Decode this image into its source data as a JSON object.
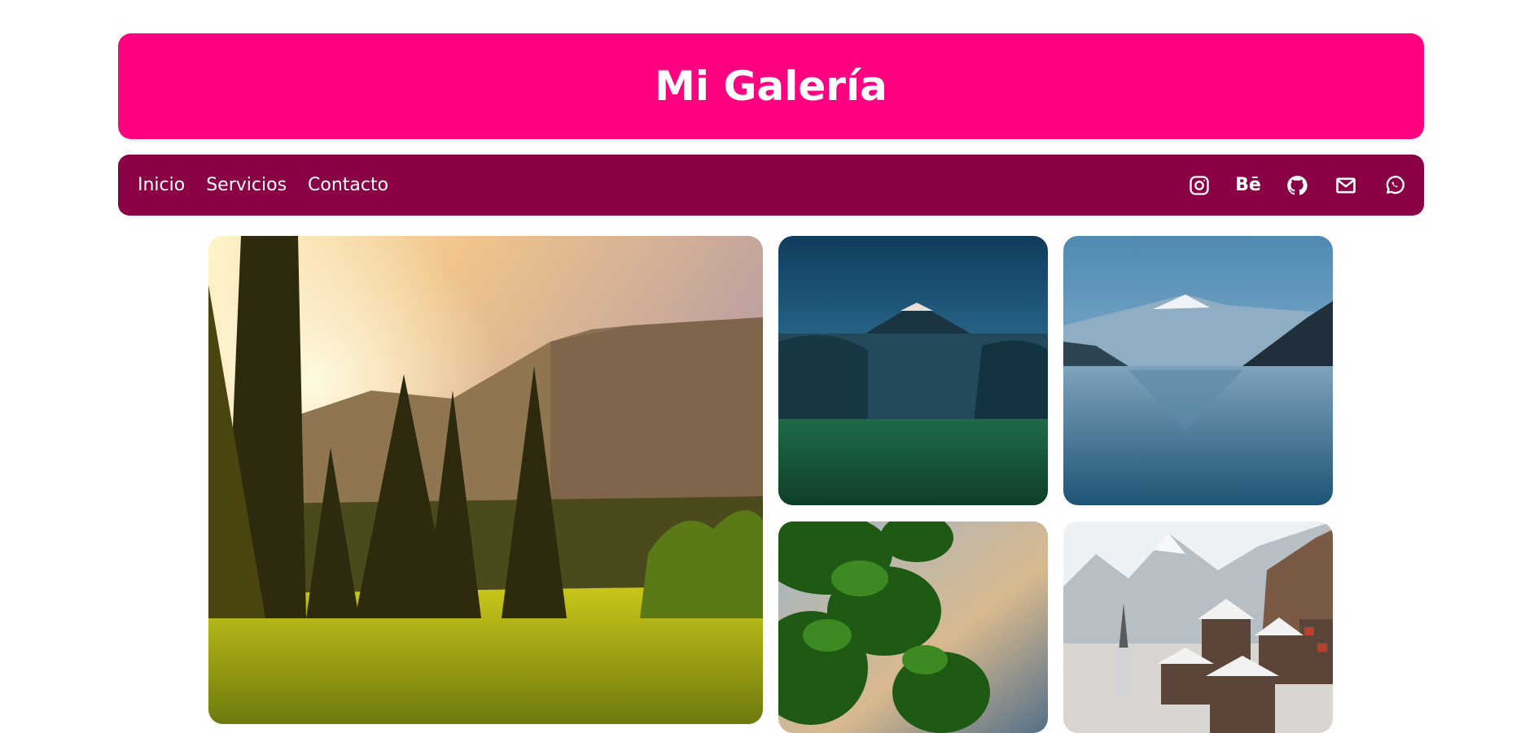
{
  "header": {
    "title": "Mi Galería"
  },
  "nav": {
    "links": [
      {
        "label": "Inicio"
      },
      {
        "label": "Servicios"
      },
      {
        "label": "Contacto"
      }
    ],
    "social": [
      {
        "icon": "instagram-icon"
      },
      {
        "icon": "behance-icon",
        "text": "Bē"
      },
      {
        "icon": "github-icon"
      },
      {
        "icon": "mail-icon"
      },
      {
        "icon": "whatsapp-icon"
      }
    ]
  },
  "gallery": {
    "photos": [
      {
        "subject": "forest-valley-sunrise"
      },
      {
        "subject": "volcano-night-sky"
      },
      {
        "subject": "mountain-lake-reflection"
      },
      {
        "subject": "tree-leaves-sky"
      },
      {
        "subject": "snowy-mountain-village"
      }
    ]
  },
  "colors": {
    "header_bg": "#ff0080",
    "nav_bg": "#8a0045",
    "text": "#ffffff"
  }
}
